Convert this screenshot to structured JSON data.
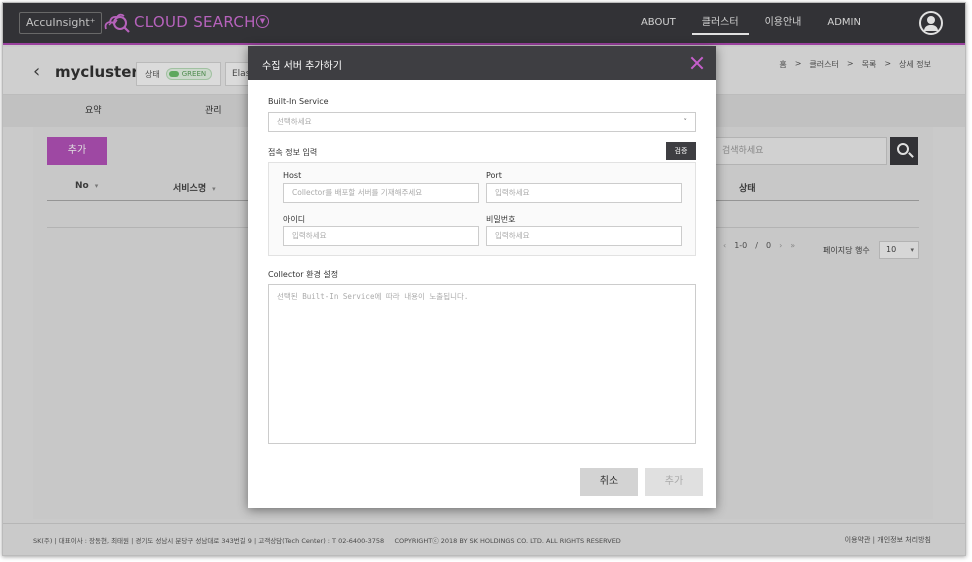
{
  "app": {
    "brand_box": "AccuInsight⁺",
    "brand_name": "CLOUD SEARCH",
    "brand_caret": "▼",
    "accent_color": "#b453ba"
  },
  "nav": {
    "items": [
      {
        "label": "ABOUT"
      },
      {
        "label": "클러스터",
        "active": true
      },
      {
        "label": "이용안내"
      },
      {
        "label": "ADMIN"
      }
    ]
  },
  "cluster": {
    "back": "‹",
    "name": "mycluster",
    "status_label": "상태",
    "status_value": "GREEN",
    "engine_partial": "Elas"
  },
  "breadcrumb": {
    "home": "홈",
    "sep": ">",
    "cluster": "클러스터",
    "list": "목록",
    "detail": "상세 정보"
  },
  "subnav": {
    "summary": "요약",
    "manage": "관리"
  },
  "content": {
    "add_button": "추가",
    "search_placeholder": "검색하세요",
    "columns": {
      "no": "No",
      "service": "서비스명",
      "status": "상태",
      "sort_caret": "▾"
    },
    "pager": {
      "prev": "‹",
      "range": "1-0",
      "slash": "/",
      "total": "0",
      "next": "›",
      "last": "»"
    },
    "per_page_label": "페이지당 행수",
    "per_page_value": "10",
    "per_page_caret": "▾"
  },
  "footer": {
    "left": "SK(주) | 대표이사 : 장동현, 최태원 | 경기도 성남시 분당구 성남대로 343번길 9 | 고객상담(Tech Center) : T 02-6400-3758     COPYRIGHTⓒ 2018 BY SK HOLDINGS CO. LTD. ALL RIGHTS RESERVED",
    "terms": "이용약관",
    "divider": "|",
    "privacy": "개인정보 처리방침"
  },
  "modal": {
    "title": "수집 서버 추가하기",
    "builtin_label": "Built-In Service",
    "builtin_placeholder": "선택하세요",
    "builtin_caret": "˅",
    "conn_label": "접속 정보 입력",
    "verify_button": "검증",
    "host_label": "Host",
    "host_placeholder": "Collector를 배포할 서버를 기재해주세요",
    "port_label": "Port",
    "port_placeholder": "입력하세요",
    "id_label": "아이디",
    "id_placeholder": "입력하세요",
    "pw_label": "비밀번호",
    "pw_placeholder": "입력하세요",
    "collector_label": "Collector 환경 설정",
    "collector_placeholder": "선택된 Built-In Service에 따라 내용이 노출됩니다.",
    "cancel_button": "취소",
    "add_button": "추가"
  }
}
